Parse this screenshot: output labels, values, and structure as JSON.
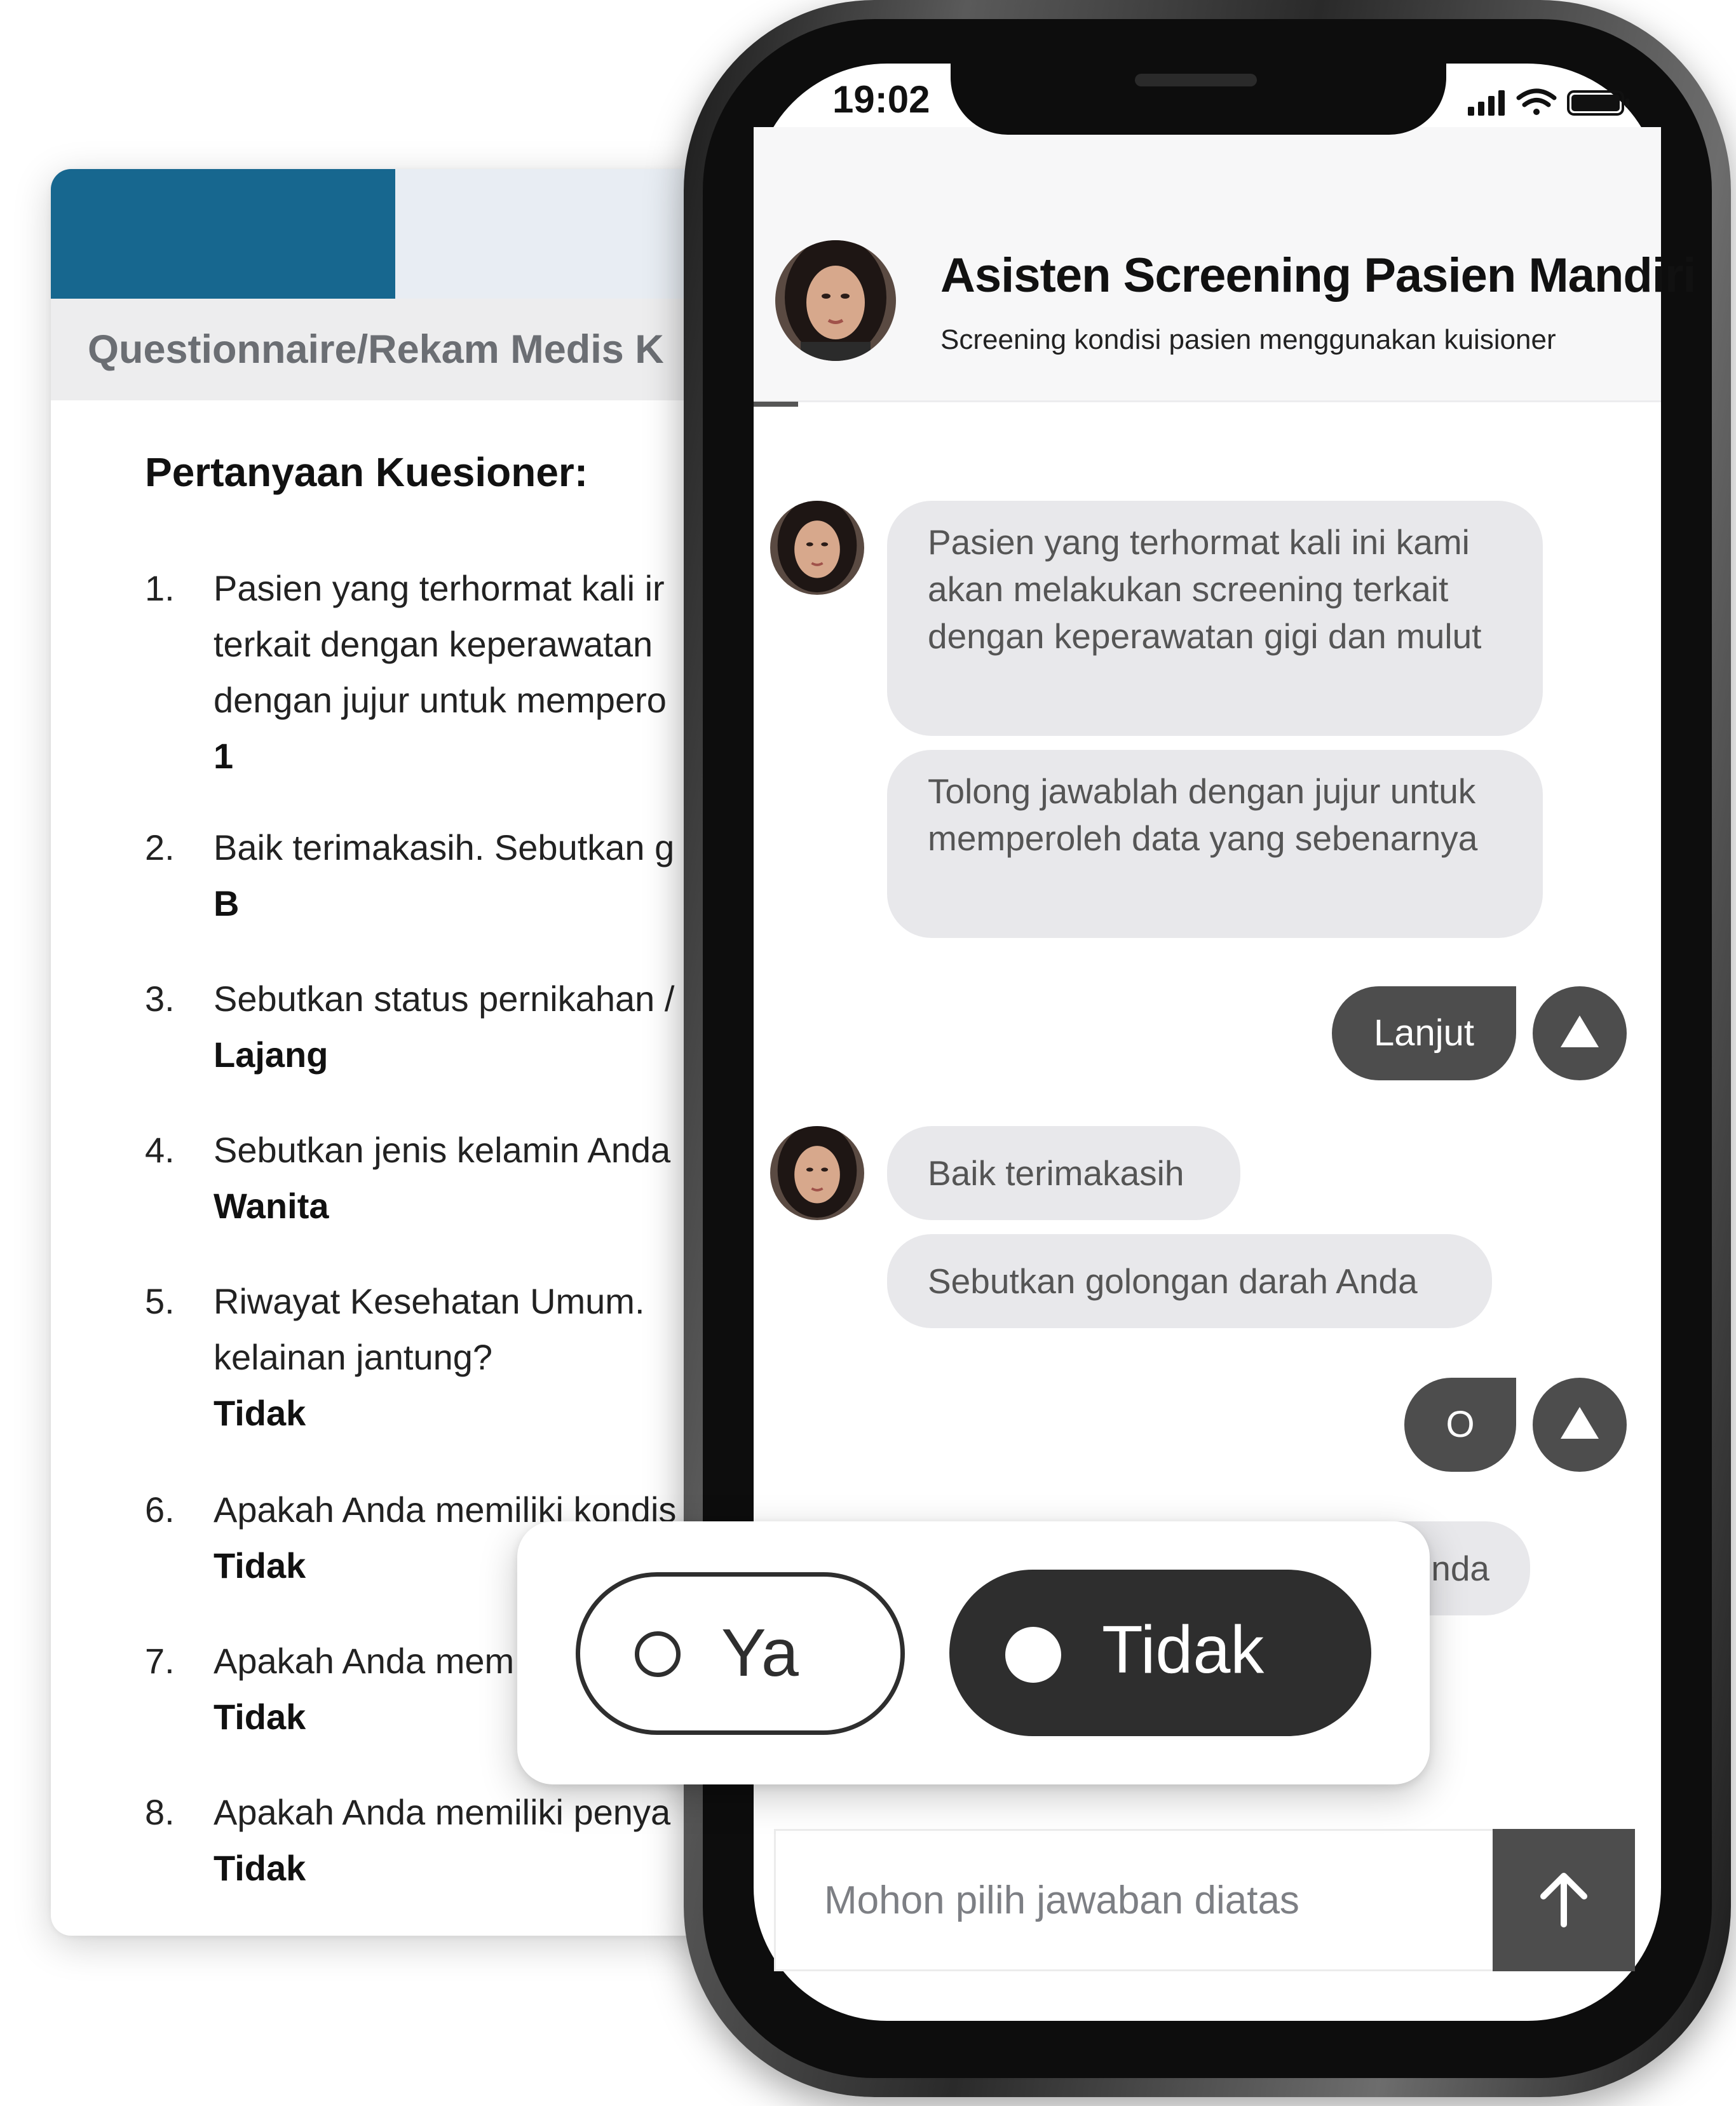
{
  "questionnaire": {
    "header_title": "Questionnaire/Rekam Medis K",
    "heading": "Pertanyaan Kuesioner:",
    "items": [
      {
        "num": "1.",
        "lines": [
          "Pasien yang terhormat kali ir",
          "terkait  dengan  keperawatan",
          "dengan jujur untuk mempero"
        ],
        "answer": "1"
      },
      {
        "num": "2.",
        "lines": [
          "Baik terimakasih. Sebutkan g"
        ],
        "answer": "B"
      },
      {
        "num": "3.",
        "lines": [
          "Sebutkan status pernikahan /"
        ],
        "answer": "Lajang"
      },
      {
        "num": "4.",
        "lines": [
          "Sebutkan jenis kelamin Anda"
        ],
        "answer": "Wanita"
      },
      {
        "num": "5.",
        "lines": [
          "Riwayat  Kesehatan  Umum.",
          "kelainan jantung?"
        ],
        "answer": "Tidak"
      },
      {
        "num": "6.",
        "lines": [
          "Apakah Anda memiliki kondis"
        ],
        "answer": "Tidak"
      },
      {
        "num": "7.",
        "lines": [
          "Apakah Anda mem"
        ],
        "answer": "Tidak"
      },
      {
        "num": "8.",
        "lines": [
          "Apakah Anda memiliki penya"
        ],
        "answer": "Tidak"
      }
    ]
  },
  "status_bar": {
    "time": "19:02"
  },
  "chat": {
    "title": "Asisten Screening Pasien Mandiri",
    "subtitle": "Screening kondisi pasien menggunakan kuisioner",
    "messages": {
      "bot1": "Pasien yang terhormat kali ini kami akan melakukan screening terkait dengan keperawatan gigi dan mulut",
      "bot2": "Tolong jawablah dengan jujur untuk memperoleh data yang sebenarnya",
      "user1": "Lanjut",
      "bot3": "Baik terimakasih",
      "bot4": "Sebutkan golongan darah Anda",
      "user2": "O",
      "bot5_partial": "nda"
    }
  },
  "choices": {
    "options": [
      "Ya",
      "Tidak"
    ],
    "selected": "Tidak"
  },
  "input": {
    "placeholder": "Mohon pilih jawaban diatas"
  },
  "colors": {
    "doc_tab_active": "#17678f",
    "bubble_bg": "#e8e8eb",
    "dark_button": "#4d4d4d",
    "selected_option": "#2e2e2e"
  }
}
